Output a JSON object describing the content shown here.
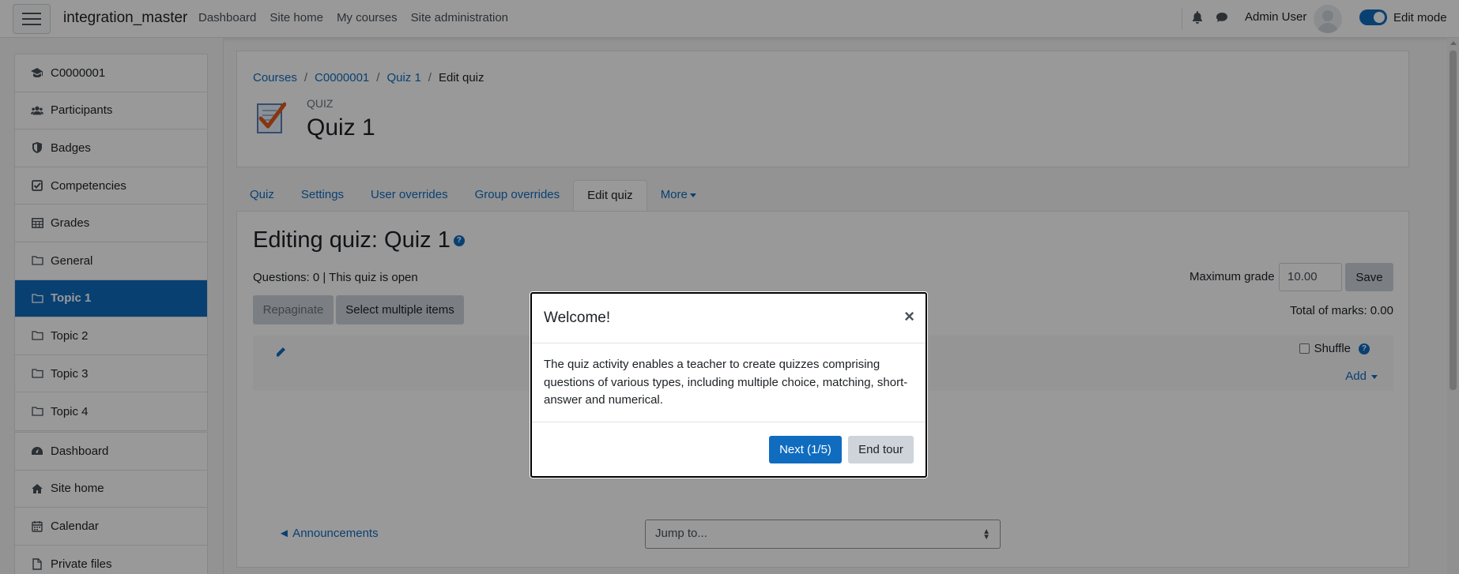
{
  "navbar": {
    "brand": "integration_master",
    "links": [
      "Dashboard",
      "Site home",
      "My courses",
      "Site administration"
    ],
    "user_name": "Admin User",
    "edit_mode_label": "Edit mode",
    "edit_mode_on": true
  },
  "sidebar": {
    "items": [
      {
        "label": "C0000001",
        "icon": "graduation-cap-icon"
      },
      {
        "label": "Participants",
        "icon": "users-icon"
      },
      {
        "label": "Badges",
        "icon": "shield-icon"
      },
      {
        "label": "Competencies",
        "icon": "check-square-icon"
      },
      {
        "label": "Grades",
        "icon": "table-icon"
      },
      {
        "label": "General",
        "icon": "folder-icon"
      },
      {
        "label": "Topic 1",
        "icon": "folder-icon",
        "active": true
      },
      {
        "label": "Topic 2",
        "icon": "folder-icon"
      },
      {
        "label": "Topic 3",
        "icon": "folder-icon"
      },
      {
        "label": "Topic 4",
        "icon": "folder-icon"
      }
    ],
    "items2": [
      {
        "label": "Dashboard",
        "icon": "dashboard-icon"
      },
      {
        "label": "Site home",
        "icon": "home-icon"
      },
      {
        "label": "Calendar",
        "icon": "calendar-icon"
      },
      {
        "label": "Private files",
        "icon": "file-icon"
      }
    ]
  },
  "header": {
    "breadcrumb": [
      "Courses",
      "C0000001",
      "Quiz 1",
      "Edit quiz"
    ],
    "kicker": "QUIZ",
    "title": "Quiz 1"
  },
  "tabs": [
    "Quiz",
    "Settings",
    "User overrides",
    "Group overrides",
    "Edit quiz",
    "More"
  ],
  "active_tab": "Edit quiz",
  "main": {
    "heading": "Editing quiz: Quiz 1",
    "status": "Questions: 0 | This quiz is open",
    "repaginate_label": "Repaginate",
    "select_multiple_label": "Select multiple items",
    "max_grade_label": "Maximum grade",
    "max_grade_value": "10.00",
    "save_label": "Save",
    "total_marks": "Total of marks: 0.00",
    "shuffle_label": "Shuffle",
    "add_label": "Add",
    "prev_activity": "◄ Announcements",
    "jump_to": "Jump to..."
  },
  "modal": {
    "title": "Welcome!",
    "body": "The quiz activity enables a teacher to create quizzes comprising questions of various types, including multiple choice, matching, short-answer and numerical.",
    "next_label": "Next (1/5)",
    "end_label": "End tour"
  },
  "colors": {
    "accent": "#0f6cbf",
    "overlay": "rgba(0,0,0,0.4)"
  }
}
